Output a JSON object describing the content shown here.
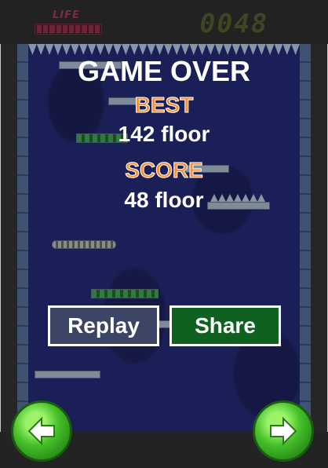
{
  "hud": {
    "life_label": "LIFE",
    "life_segments": 10,
    "score_counter": "0048"
  },
  "overlay": {
    "title": "GAME OVER",
    "best_label": "BEST",
    "best_value": "142 floor",
    "score_label": "SCORE",
    "score_value": "48 floor"
  },
  "buttons": {
    "replay_label": "Replay",
    "share_label": "Share"
  },
  "controls": {
    "left_icon": "left-arrow-icon",
    "right_icon": "right-arrow-icon"
  },
  "colors": {
    "field_bg": "#1b1f57",
    "label_orange": "#f7923a",
    "replay_bg": "#3c4566",
    "share_bg": "#0f6120",
    "arrow_green": "#46c02a"
  }
}
